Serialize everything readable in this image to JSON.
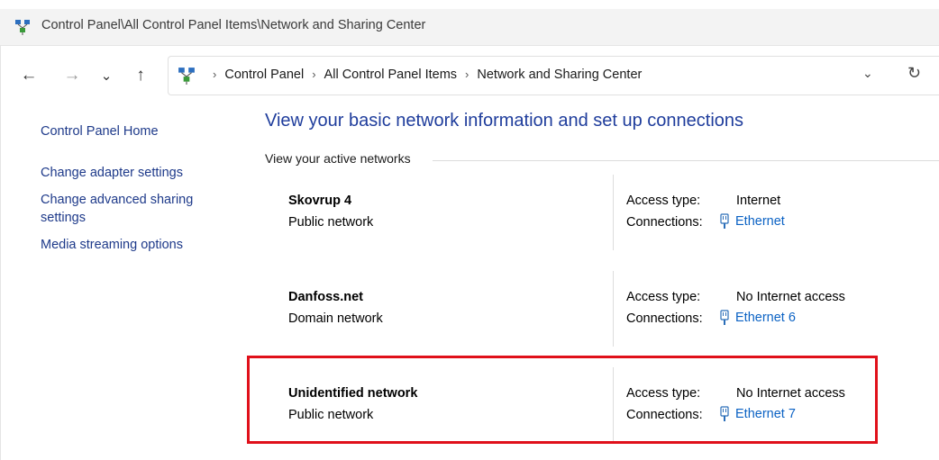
{
  "window": {
    "title": "Control Panel\\All Control Panel Items\\Network and Sharing Center",
    "icon": "network-center-icon"
  },
  "nav": {
    "back_icon": "back-arrow-icon",
    "forward_icon": "forward-arrow-icon",
    "recent_icon": "chevron-down-icon",
    "up_icon": "up-arrow-icon",
    "back": "←",
    "forward": "→",
    "recent": "⌄",
    "up": "↑"
  },
  "address": {
    "crumbs": [
      "Control Panel",
      "All Control Panel Items",
      "Network and Sharing Center"
    ],
    "separator": "›",
    "dropdown": "⌄",
    "refresh": "↻"
  },
  "sidebar": {
    "home": "Control Panel Home",
    "links": [
      "Change adapter settings",
      "Change advanced sharing settings",
      "Media streaming options"
    ]
  },
  "main": {
    "title": "View your basic network information and set up connections",
    "section": "View your active networks",
    "access_label": "Access type:",
    "connections_label": "Connections:",
    "networks": [
      {
        "name": "Skovrup 4",
        "type": "Public network",
        "access": "Internet",
        "connection": "Ethernet"
      },
      {
        "name": "Danfoss.net",
        "type": "Domain network",
        "access": "No Internet access",
        "connection": "Ethernet 6"
      },
      {
        "name": "Unidentified network",
        "type": "Public network",
        "access": "No Internet access",
        "connection": "Ethernet 7"
      }
    ]
  },
  "colors": {
    "link": "#1e3a8a",
    "title": "#1f3d9c",
    "connection_link": "#0b62c4",
    "highlight": "#e0101a"
  }
}
